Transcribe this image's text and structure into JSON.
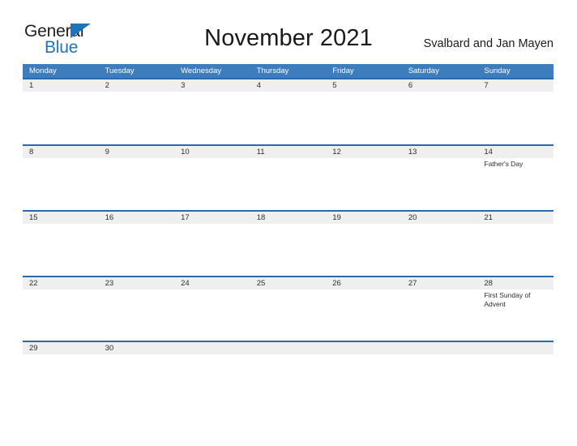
{
  "brand": {
    "name_part1": "General",
    "name_part2": "Blue",
    "flag_icon": "flag-triangle-icon",
    "accent_color": "#1c75bc"
  },
  "header": {
    "title": "November 2021",
    "locale": "Svalbard and Jan Mayen"
  },
  "calendar": {
    "month": "November",
    "year": "2021",
    "header_color": "#3d7cbd",
    "band_color": "#efeff0",
    "rule_color": "#2a6aad",
    "day_headers": [
      "Monday",
      "Tuesday",
      "Wednesday",
      "Thursday",
      "Friday",
      "Saturday",
      "Sunday"
    ],
    "weeks": [
      {
        "days": [
          {
            "num": "1",
            "event": ""
          },
          {
            "num": "2",
            "event": ""
          },
          {
            "num": "3",
            "event": ""
          },
          {
            "num": "4",
            "event": ""
          },
          {
            "num": "5",
            "event": ""
          },
          {
            "num": "6",
            "event": ""
          },
          {
            "num": "7",
            "event": ""
          }
        ]
      },
      {
        "days": [
          {
            "num": "8",
            "event": ""
          },
          {
            "num": "9",
            "event": ""
          },
          {
            "num": "10",
            "event": ""
          },
          {
            "num": "11",
            "event": ""
          },
          {
            "num": "12",
            "event": ""
          },
          {
            "num": "13",
            "event": ""
          },
          {
            "num": "14",
            "event": "Father's Day"
          }
        ]
      },
      {
        "days": [
          {
            "num": "15",
            "event": ""
          },
          {
            "num": "16",
            "event": ""
          },
          {
            "num": "17",
            "event": ""
          },
          {
            "num": "18",
            "event": ""
          },
          {
            "num": "19",
            "event": ""
          },
          {
            "num": "20",
            "event": ""
          },
          {
            "num": "21",
            "event": ""
          }
        ]
      },
      {
        "days": [
          {
            "num": "22",
            "event": ""
          },
          {
            "num": "23",
            "event": ""
          },
          {
            "num": "24",
            "event": ""
          },
          {
            "num": "25",
            "event": ""
          },
          {
            "num": "26",
            "event": ""
          },
          {
            "num": "27",
            "event": ""
          },
          {
            "num": "28",
            "event": "First Sunday of Advent"
          }
        ]
      },
      {
        "days": [
          {
            "num": "29",
            "event": ""
          },
          {
            "num": "30",
            "event": ""
          },
          {
            "num": "",
            "event": ""
          },
          {
            "num": "",
            "event": ""
          },
          {
            "num": "",
            "event": ""
          },
          {
            "num": "",
            "event": ""
          },
          {
            "num": "",
            "event": ""
          }
        ]
      }
    ]
  }
}
